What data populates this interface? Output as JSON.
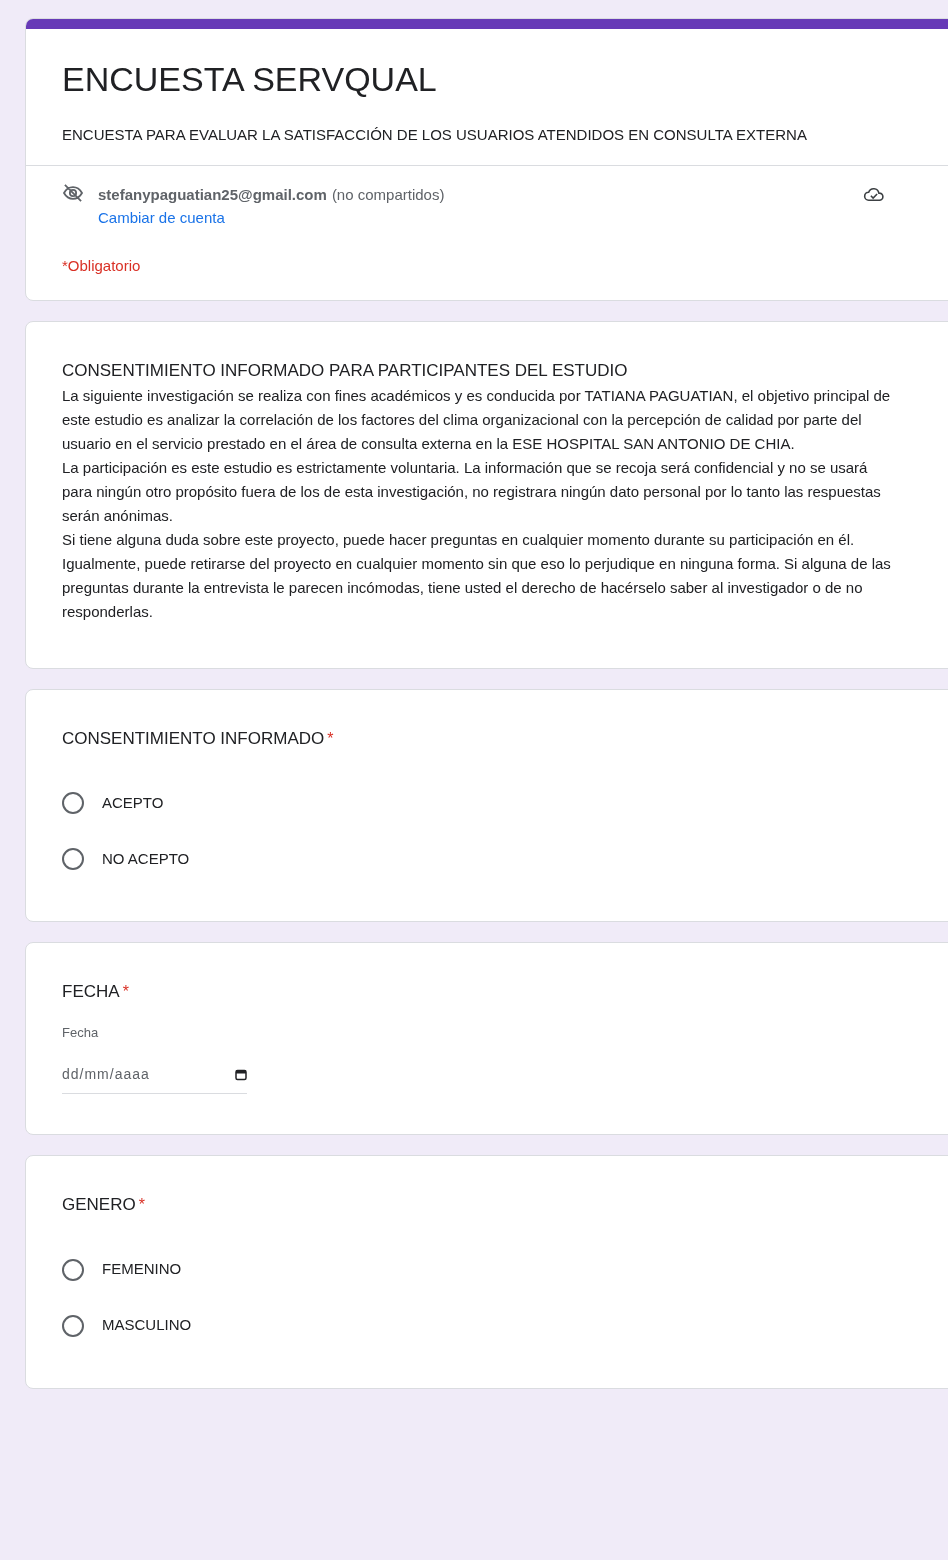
{
  "header": {
    "title": "ENCUESTA SERVQUAL",
    "description": "ENCUESTA PARA EVALUAR LA SATISFACCIÓN DE LOS USUARIOS ATENDIDOS EN CONSULTA EXTERNA",
    "account_email": "stefanypaguatian25@gmail.com",
    "account_note": "(no compartidos)",
    "switch_account": "Cambiar de cuenta",
    "required_note": "*Obligatorio"
  },
  "intro": {
    "heading": "CONSENTIMIENTO INFORMADO PARA PARTICIPANTES DEL ESTUDIO",
    "paragraphs": [
      "La siguiente investigación se realiza con fines académicos y es conducida por TATIANA PAGUATIAN,  el objetivo principal de este estudio es analizar la correlación de los factores del clima organizacional con la percepción de calidad por parte del usuario en el servicio prestado en el área de consulta externa en la ESE HOSPITAL SAN ANTONIO DE CHIA.",
      "La participación es este estudio es estrictamente voluntaria. La información que se recoja será confidencial y no se usará para ningún otro propósito fuera de los de esta investigación, no registrara ningún dato personal por lo tanto las respuestas serán anónimas.",
      "Si tiene alguna duda sobre este proyecto, puede hacer preguntas en cualquier momento durante su participación en él. Igualmente, puede retirarse del proyecto en cualquier momento sin que eso lo perjudique en ninguna forma. Si alguna de las preguntas durante la entrevista le parecen incómodas, tiene usted el derecho de hacérselo saber al investigador o de no responderlas."
    ]
  },
  "questions": [
    {
      "kind": "radio",
      "title": "CONSENTIMIENTO INFORMADO",
      "required_mark": "*",
      "options": [
        {
          "label": "ACEPTO",
          "selected": false
        },
        {
          "label": "NO ACEPTO",
          "selected": false
        }
      ]
    },
    {
      "kind": "date",
      "title": "FECHA",
      "required_mark": "*",
      "field_label": "Fecha",
      "placeholder": "dd/mm/aaaa"
    },
    {
      "kind": "radio",
      "title": "GENERO",
      "required_mark": "*",
      "options": [
        {
          "label": "FEMENINO",
          "selected": false
        },
        {
          "label": "MASCULINO",
          "selected": false
        }
      ]
    }
  ]
}
